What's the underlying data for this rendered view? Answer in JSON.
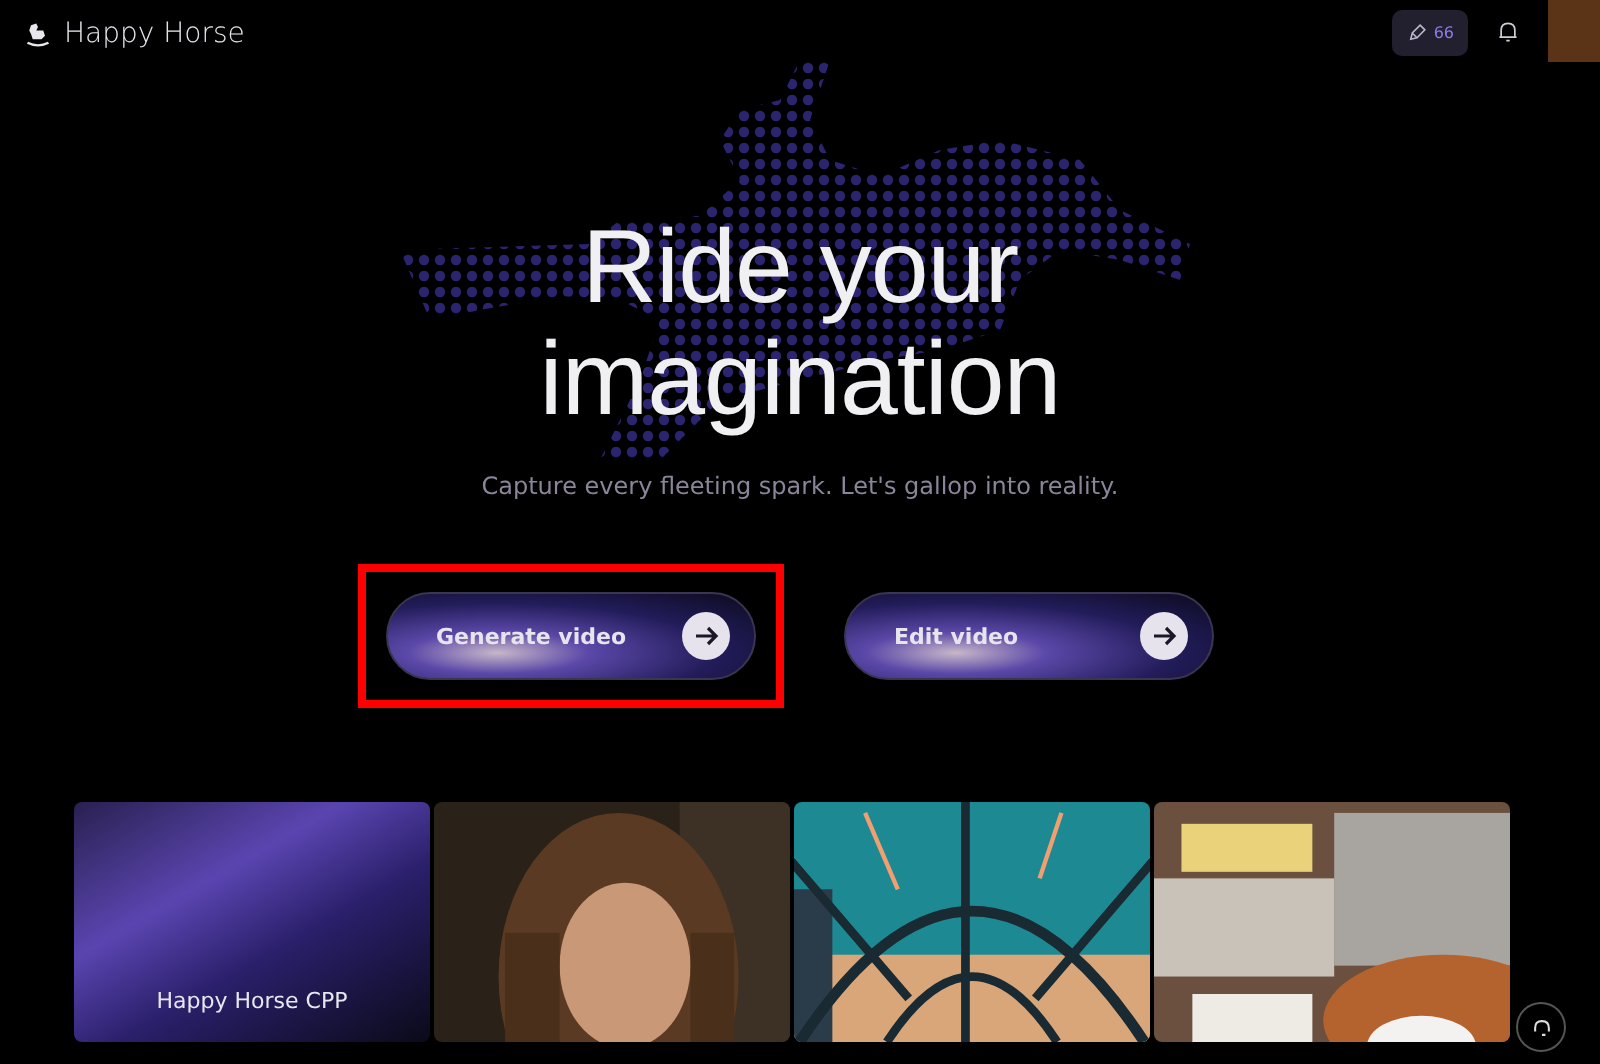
{
  "header": {
    "brand": "Happy Horse",
    "credits": "66"
  },
  "hero": {
    "title_lines": [
      "Ride your",
      "imagination"
    ],
    "subtitle": "Capture every fleeting spark. Let's gallop into reality."
  },
  "actions": [
    {
      "label": "Generate video",
      "highlighted": true
    },
    {
      "label": "Edit video",
      "highlighted": false
    }
  ],
  "gallery": [
    {
      "kind": "promo",
      "caption": "Happy Horse CPP"
    },
    {
      "kind": "picture"
    },
    {
      "kind": "picture"
    },
    {
      "kind": "picture"
    }
  ]
}
